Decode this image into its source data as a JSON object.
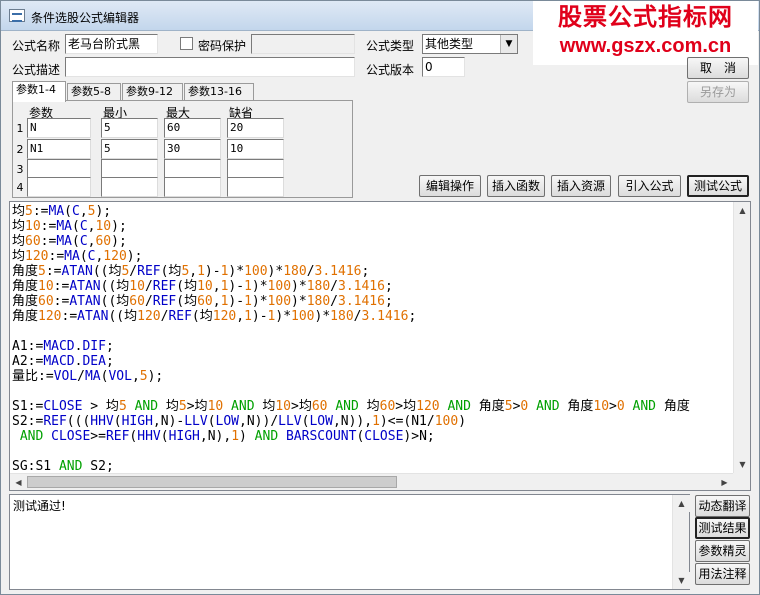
{
  "window": {
    "title": "条件选股公式编辑器"
  },
  "watermark": {
    "line1": "股票公式指标网",
    "line2": "www.gszx.com.cn"
  },
  "form": {
    "name_label": "公式名称",
    "name_value": "老马台阶式黑",
    "password_label": "密码保护",
    "password_checked": false,
    "type_label": "公式类型",
    "type_value": "其他类型",
    "desc_label": "公式描述",
    "desc_value": "",
    "version_label": "公式版本",
    "version_value": "0"
  },
  "buttons": {
    "cancel": "取　消",
    "save_as": "另存为",
    "edit_op": "编辑操作",
    "insert_func": "插入函数",
    "insert_res": "插入资源",
    "import_formula": "引入公式",
    "test_formula": "测试公式",
    "dynamic_translate": "动态翻译",
    "test_result": "测试结果",
    "param_wizard": "参数精灵",
    "usage_notes": "用法注释"
  },
  "tabs": [
    "参数1-4",
    "参数5-8",
    "参数9-12",
    "参数13-16"
  ],
  "params": {
    "headers": [
      "参数",
      "最小",
      "最大",
      "缺省"
    ],
    "rows": [
      {
        "no": "1",
        "name": "N",
        "min": "5",
        "max": "60",
        "default": "20"
      },
      {
        "no": "2",
        "name": "N1",
        "min": "5",
        "max": "30",
        "default": "10"
      },
      {
        "no": "3",
        "name": "",
        "min": "",
        "max": "",
        "default": ""
      },
      {
        "no": "4",
        "name": "",
        "min": "",
        "max": "",
        "default": ""
      }
    ]
  },
  "code_lines": [
    "均5:=MA(C,5);",
    "均10:=MA(C,10);",
    "均60:=MA(C,60);",
    "均120:=MA(C,120);",
    "角度5:=ATAN((均5/REF(均5,1)-1)*100)*180/3.1416;",
    "角度10:=ATAN((均10/REF(均10,1)-1)*100)*180/3.1416;",
    "角度60:=ATAN((均60/REF(均60,1)-1)*100)*180/3.1416;",
    "角度120:=ATAN((均120/REF(均120,1)-1)*100)*180/3.1416;",
    "",
    "A1:=MACD.DIF;",
    "A2:=MACD.DEA;",
    "量比:=VOL/MA(VOL,5);",
    "",
    "S1:=CLOSE > 均5 AND 均5>均10 AND 均10>均60 AND 均60>均120 AND 角度5>0 AND 角度10>0 AND 角度",
    "S2:=REF(((HHV(HIGH,N)-LLV(LOW,N))/LLV(LOW,N)),1)<=(N1/100)",
    " AND CLOSE>=REF(HHV(HIGH,N),1) AND BARSCOUNT(CLOSE)>N;",
    "",
    "SG:S1 AND S2;"
  ],
  "output": {
    "text": "测试通过!"
  },
  "colors": {
    "function": "#0000c8",
    "number": "#e07000",
    "keyword": "#00a000",
    "watermark": "#e0001a"
  }
}
